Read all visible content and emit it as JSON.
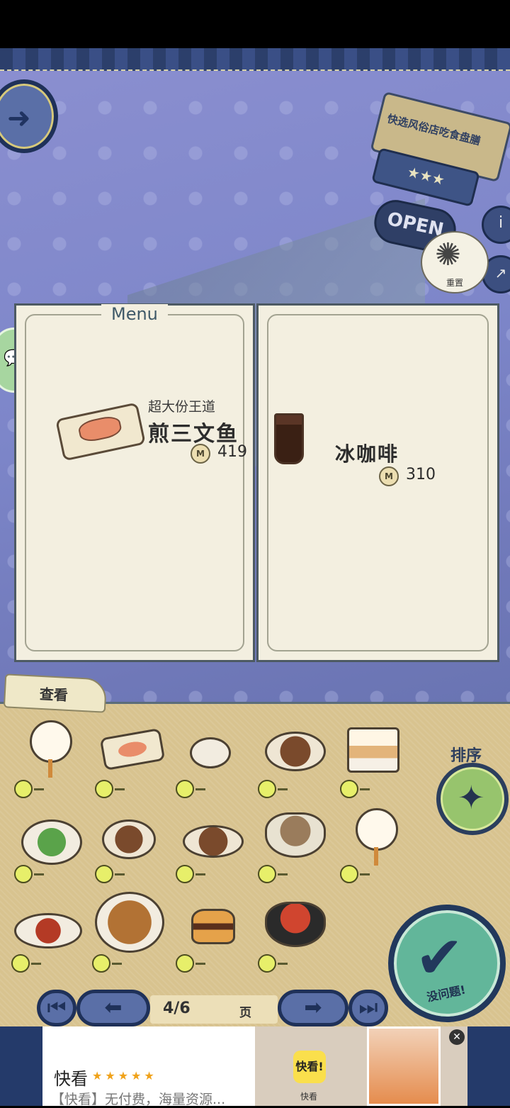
{
  "signs": {
    "shop_name": "快选风俗店吃食盘膳",
    "rating": "★★★",
    "open": "OPEN"
  },
  "buttons": {
    "reset_label": "重置",
    "info_icon": "i",
    "sort_label": "排序",
    "confirm_label": "没问题!",
    "view_tab": "查看"
  },
  "menu": {
    "title": "Menu",
    "left": {
      "subtitle": "超大份王道",
      "name": "煎三文鱼",
      "price": "419",
      "coin_symbol": "M"
    },
    "right": {
      "name": "冰咖啡",
      "price": "310",
      "coin_symbol": "M"
    }
  },
  "pager": {
    "current": "4/6",
    "unit": "页"
  },
  "items": [
    {
      "icon": "cotton-candy"
    },
    {
      "icon": "grilled-salmon"
    },
    {
      "icon": "dim-sum"
    },
    {
      "icon": "fried-noodles"
    },
    {
      "icon": "strawberry-cake"
    },
    {
      "icon": "salad"
    },
    {
      "icon": "rice-balls"
    },
    {
      "icon": "steak"
    },
    {
      "icon": "noodle-soup"
    },
    {
      "icon": "cotton-candy"
    },
    {
      "icon": "omelette-plate"
    },
    {
      "icon": "pork-cutlet"
    },
    {
      "icon": "burger"
    },
    {
      "icon": "seafood-bowl"
    }
  ],
  "ad": {
    "brand": "快看",
    "stars": "★★★★★",
    "description": "【快看】无付费，海量资源...",
    "logo_text": "快看!",
    "logo_caption": "快看",
    "close_icon": "✕"
  }
}
